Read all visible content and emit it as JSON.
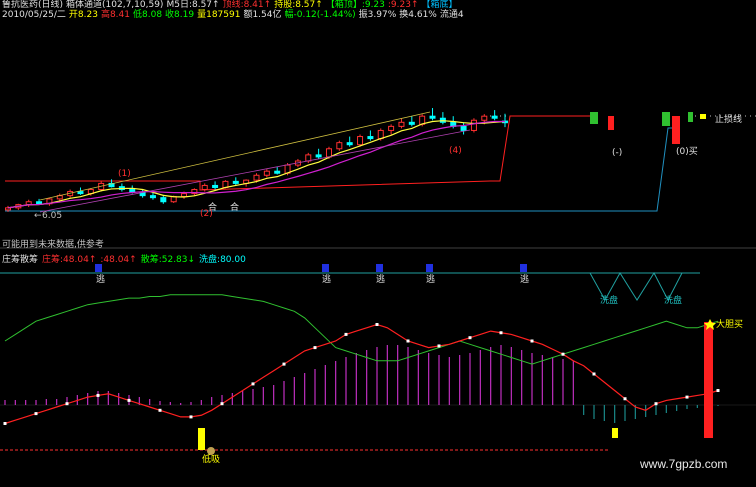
{
  "header": {
    "line1": [
      {
        "text": "鲁抗医药(日线)",
        "color": "#e0e0e0"
      },
      {
        "text": "箱体通道(102,7,10,59)",
        "color": "#e0e0e0"
      },
      {
        "text": "M5日:8.57↑",
        "color": "#e0e0e0"
      },
      {
        "text": "顶线:8.41↑",
        "color": "#ff3030"
      },
      {
        "text": "持股:8.57↑",
        "color": "#ffff00"
      },
      {
        "text": "【箱顶】:9.23",
        "color": "#00ff00"
      },
      {
        "text": ":9.23↑",
        "color": "#ff3030"
      },
      {
        "text": "【箱底】",
        "color": "#00c0ff"
      }
    ],
    "line2": [
      {
        "text": "2010/05/25/二",
        "color": "#e0e0e0"
      },
      {
        "text": "开8.23",
        "color": "#ffff00"
      },
      {
        "text": "高8.41",
        "color": "#ff3030"
      },
      {
        "text": "低8.08",
        "color": "#00ff00"
      },
      {
        "text": "收8.19",
        "color": "#00ff00"
      },
      {
        "text": "量187591",
        "color": "#ffff00"
      },
      {
        "text": "额1.54亿",
        "color": "#e0e0e0"
      },
      {
        "text": "幅-0.12(-1.44%)",
        "color": "#00ff00"
      },
      {
        "text": "振3.97%",
        "color": "#e0e0e0"
      },
      {
        "text": "换4.61%",
        "color": "#e0e0e0"
      },
      {
        "text": "流通4",
        "color": "#e0e0e0"
      }
    ]
  },
  "note": "可能用到未来数据,供参考",
  "indicator_header": [
    {
      "text": "庄筹散筹",
      "color": "#e0e0e0"
    },
    {
      "text": "庄筹:48.04↑",
      "color": "#ff3030"
    },
    {
      "text": ":48.04↑",
      "color": "#ff3030"
    },
    {
      "text": "散筹:52.83↓",
      "color": "#00ff00"
    },
    {
      "text": "洗盘:80.00",
      "color": "#00ffff"
    }
  ],
  "annotations": {
    "price_label": "6.05",
    "signal_he": "合",
    "signal_he2": "合",
    "mark_1a": "(1)",
    "mark_1b": "(1)",
    "mark_2": "(2)",
    "mark_4": "(4)",
    "stop_loss": "止损线",
    "buy_signal": "(0)买",
    "mark_paren": "(-)",
    "tiao_1": "逃",
    "tiao_2": "逃",
    "tiao_3": "逃",
    "tiao_4": "逃",
    "tiao_5": "逃",
    "wash_1": "洗盘",
    "wash_2": "洗盘",
    "big_buy": "大胆买",
    "low_buy": "低吸"
  },
  "watermark": "www.7gpzb.com",
  "colors": {
    "up": "#ff3030",
    "down": "#00ffff",
    "ma_yellow": "#ffff40",
    "ma_magenta": "#d020d0",
    "box_red": "#ff2020",
    "channel_cyan": "#2090c0",
    "zhuang": "#ff2020",
    "san": "#30c030",
    "hist_pos": "#c030c0",
    "hist_neg": "#1a8a8a"
  },
  "chart_data": {
    "type": "candlestick+indicator",
    "price_axis": "unlabeled",
    "note": "Y axis carries no printed ticks; values below are in the chart's own units as drawn (price scale read from header: close 8.19).",
    "candles": [
      {
        "o": 6.05,
        "h": 6.15,
        "l": 6.0,
        "c": 6.1
      },
      {
        "o": 6.1,
        "h": 6.2,
        "l": 6.05,
        "c": 6.18
      },
      {
        "o": 6.18,
        "h": 6.3,
        "l": 6.12,
        "c": 6.25
      },
      {
        "o": 6.25,
        "h": 6.32,
        "l": 6.18,
        "c": 6.2
      },
      {
        "o": 6.2,
        "h": 6.35,
        "l": 6.15,
        "c": 6.32
      },
      {
        "o": 6.32,
        "h": 6.45,
        "l": 6.28,
        "c": 6.4
      },
      {
        "o": 6.4,
        "h": 6.55,
        "l": 6.35,
        "c": 6.5
      },
      {
        "o": 6.5,
        "h": 6.6,
        "l": 6.42,
        "c": 6.45
      },
      {
        "o": 6.45,
        "h": 6.58,
        "l": 6.4,
        "c": 6.55
      },
      {
        "o": 6.55,
        "h": 6.75,
        "l": 6.5,
        "c": 6.7
      },
      {
        "o": 6.7,
        "h": 6.8,
        "l": 6.6,
        "c": 6.62
      },
      {
        "o": 6.62,
        "h": 6.7,
        "l": 6.5,
        "c": 6.55
      },
      {
        "o": 6.55,
        "h": 6.65,
        "l": 6.45,
        "c": 6.48
      },
      {
        "o": 6.48,
        "h": 6.55,
        "l": 6.35,
        "c": 6.4
      },
      {
        "o": 6.4,
        "h": 6.48,
        "l": 6.3,
        "c": 6.35
      },
      {
        "o": 6.35,
        "h": 6.42,
        "l": 6.2,
        "c": 6.25
      },
      {
        "o": 6.25,
        "h": 6.4,
        "l": 6.22,
        "c": 6.38
      },
      {
        "o": 6.38,
        "h": 6.5,
        "l": 6.32,
        "c": 6.45
      },
      {
        "o": 6.45,
        "h": 6.58,
        "l": 6.4,
        "c": 6.55
      },
      {
        "o": 6.55,
        "h": 6.7,
        "l": 6.5,
        "c": 6.65
      },
      {
        "o": 6.65,
        "h": 6.75,
        "l": 6.55,
        "c": 6.6
      },
      {
        "o": 6.6,
        "h": 6.78,
        "l": 6.58,
        "c": 6.75
      },
      {
        "o": 6.75,
        "h": 6.85,
        "l": 6.65,
        "c": 6.7
      },
      {
        "o": 6.7,
        "h": 6.8,
        "l": 6.62,
        "c": 6.78
      },
      {
        "o": 6.78,
        "h": 6.95,
        "l": 6.72,
        "c": 6.9
      },
      {
        "o": 6.9,
        "h": 7.05,
        "l": 6.85,
        "c": 7.0
      },
      {
        "o": 7.0,
        "h": 7.1,
        "l": 6.92,
        "c": 6.95
      },
      {
        "o": 6.95,
        "h": 7.2,
        "l": 6.9,
        "c": 7.15
      },
      {
        "o": 7.15,
        "h": 7.3,
        "l": 7.1,
        "c": 7.25
      },
      {
        "o": 7.25,
        "h": 7.45,
        "l": 7.2,
        "c": 7.4
      },
      {
        "o": 7.4,
        "h": 7.55,
        "l": 7.3,
        "c": 7.35
      },
      {
        "o": 7.35,
        "h": 7.6,
        "l": 7.3,
        "c": 7.55
      },
      {
        "o": 7.55,
        "h": 7.75,
        "l": 7.5,
        "c": 7.7
      },
      {
        "o": 7.7,
        "h": 7.85,
        "l": 7.6,
        "c": 7.65
      },
      {
        "o": 7.65,
        "h": 7.9,
        "l": 7.6,
        "c": 7.85
      },
      {
        "o": 7.85,
        "h": 8.0,
        "l": 7.75,
        "c": 7.8
      },
      {
        "o": 7.8,
        "h": 8.05,
        "l": 7.75,
        "c": 8.0
      },
      {
        "o": 8.0,
        "h": 8.15,
        "l": 7.9,
        "c": 8.1
      },
      {
        "o": 8.1,
        "h": 8.3,
        "l": 8.05,
        "c": 8.2
      },
      {
        "o": 8.2,
        "h": 8.35,
        "l": 8.1,
        "c": 8.15
      },
      {
        "o": 8.15,
        "h": 8.4,
        "l": 8.1,
        "c": 8.35
      },
      {
        "o": 8.35,
        "h": 8.55,
        "l": 8.25,
        "c": 8.3
      },
      {
        "o": 8.3,
        "h": 8.45,
        "l": 8.15,
        "c": 8.2
      },
      {
        "o": 8.2,
        "h": 8.35,
        "l": 8.05,
        "c": 8.1
      },
      {
        "o": 8.1,
        "h": 8.2,
        "l": 7.9,
        "c": 8.0
      },
      {
        "o": 8.0,
        "h": 8.3,
        "l": 7.95,
        "c": 8.25
      },
      {
        "o": 8.25,
        "h": 8.4,
        "l": 8.15,
        "c": 8.35
      },
      {
        "o": 8.35,
        "h": 8.5,
        "l": 8.25,
        "c": 8.3
      },
      {
        "o": 8.23,
        "h": 8.41,
        "l": 8.08,
        "c": 8.19
      }
    ],
    "zhuang_chou": [
      10,
      12,
      14,
      16,
      18,
      20,
      22,
      24,
      26,
      27,
      28,
      26,
      24,
      22,
      20,
      18,
      16,
      14,
      14,
      15,
      18,
      22,
      26,
      30,
      34,
      38,
      42,
      46,
      50,
      54,
      56,
      58,
      60,
      64,
      66,
      68,
      70,
      68,
      64,
      60,
      58,
      56,
      57,
      58,
      60,
      62,
      64,
      66,
      65,
      64,
      62,
      60,
      58,
      55,
      52,
      48,
      45,
      40,
      35,
      30,
      25,
      20,
      18,
      22,
      24,
      25,
      26,
      27,
      28,
      30
    ],
    "san_chou": [
      60,
      64,
      68,
      72,
      74,
      76,
      78,
      80,
      82,
      83,
      84,
      85,
      86,
      86,
      87,
      87,
      88,
      88,
      88,
      88,
      88,
      88,
      87,
      86,
      85,
      84,
      82,
      80,
      78,
      74,
      68,
      62,
      56,
      54,
      52,
      50,
      48,
      48,
      48,
      50,
      52,
      54,
      56,
      58,
      60,
      58,
      56,
      54,
      52,
      50,
      48,
      46,
      48,
      50,
      52,
      54,
      56,
      58,
      60,
      62,
      64,
      66,
      68,
      70,
      72,
      70,
      68,
      68,
      70,
      72
    ],
    "histogram": [
      5,
      5,
      5,
      5,
      6,
      6,
      8,
      10,
      12,
      14,
      14,
      12,
      10,
      8,
      6,
      4,
      3,
      2,
      3,
      5,
      8,
      10,
      12,
      14,
      16,
      18,
      20,
      24,
      28,
      32,
      36,
      40,
      44,
      48,
      52,
      55,
      58,
      60,
      60,
      58,
      55,
      52,
      50,
      48,
      50,
      52,
      55,
      58,
      60,
      58,
      55,
      52,
      50,
      48,
      46,
      44,
      -10,
      -14,
      -16,
      -18,
      -16,
      -14,
      -12,
      -10,
      -8,
      -6,
      -4,
      -3,
      -2,
      -1
    ]
  }
}
